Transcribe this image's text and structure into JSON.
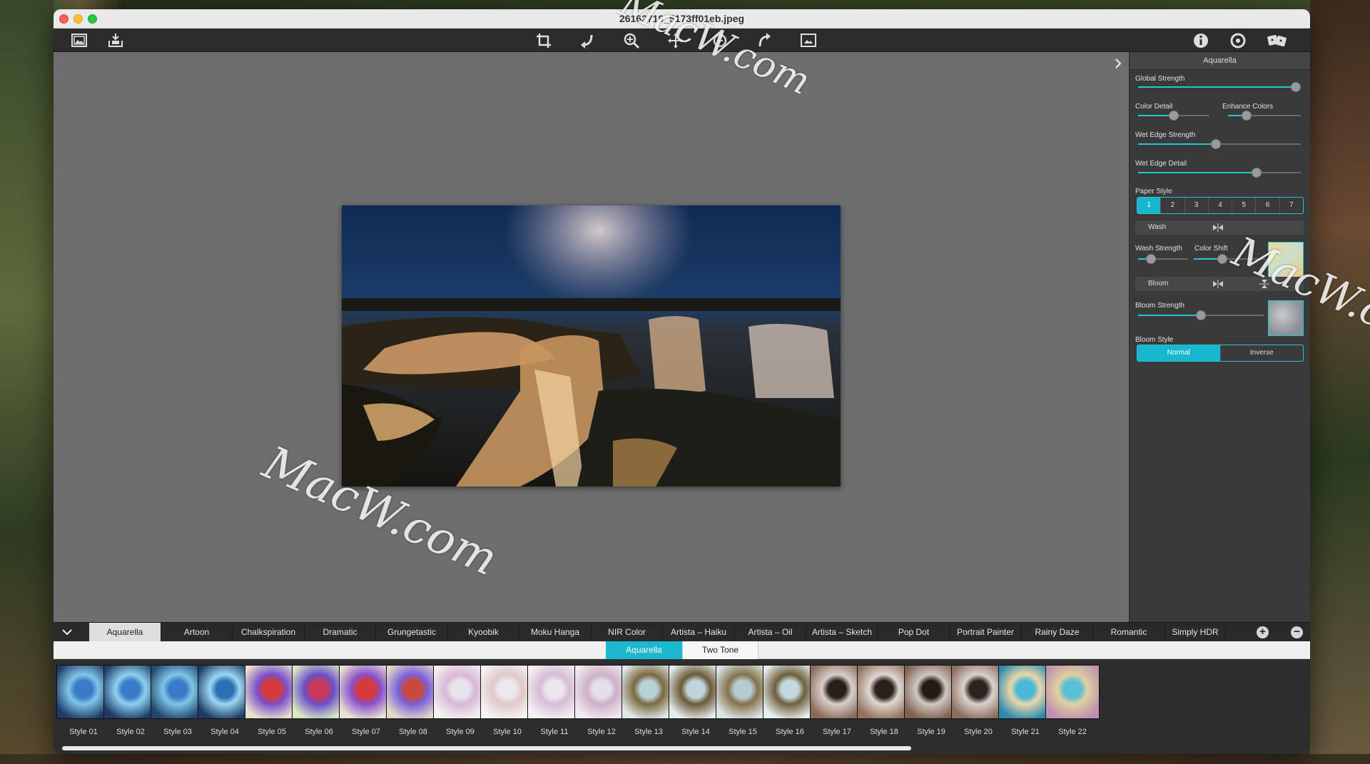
{
  "window": {
    "title": "26162719_5173ff01eb.jpeg"
  },
  "panel": {
    "title": "Aquarella",
    "global_strength": {
      "label": "Global Strength",
      "value": 0.97
    },
    "color_detail": {
      "label": "Color Detail",
      "value": 0.5
    },
    "enhance_colors": {
      "label": "Enhance Colors",
      "value": 0.25
    },
    "wet_edge_strength": {
      "label": "Wet Edge Strength",
      "value": 0.48
    },
    "wet_edge_detail": {
      "label": "Wet Edge Detail",
      "value": 0.73
    },
    "paper_style": {
      "label": "Paper Style",
      "options": [
        "1",
        "2",
        "3",
        "4",
        "5",
        "6",
        "7"
      ],
      "selected": "1"
    },
    "wash": {
      "label": "Wash"
    },
    "wash_strength": {
      "label": "Wash Strength",
      "value": 0.25
    },
    "color_shift": {
      "label": "Color Shift",
      "value": 0.4
    },
    "bloom": {
      "label": "Bloom"
    },
    "bloom_strength": {
      "label": "Bloom Strength",
      "value": 0.5
    },
    "bloom_style": {
      "label": "Bloom Style",
      "options": [
        "Normal",
        "Inverse"
      ],
      "selected": "Normal"
    }
  },
  "tabs": [
    "Aquarella",
    "Artoon",
    "Chalkspiration",
    "Dramatic",
    "Grungetastic",
    "Kyoobik",
    "Moku Hanga",
    "NIR Color",
    "Artista – Haiku",
    "Artista – Oil",
    "Artista – Sketch",
    "Pop Dot",
    "Portrait Painter",
    "Rainy Daze",
    "Romantic",
    "Simply HDR"
  ],
  "active_tab": "Aquarella",
  "subtabs": [
    "Aquarella",
    "Two Tone"
  ],
  "active_subtab": "Aquarella",
  "styles": [
    "Style 01",
    "Style 02",
    "Style 03",
    "Style 04",
    "Style 05",
    "Style 06",
    "Style 07",
    "Style 08",
    "Style 09",
    "Style 10",
    "Style 11",
    "Style 12",
    "Style 13",
    "Style 14",
    "Style 15",
    "Style 16",
    "Style 17",
    "Style 18",
    "Style 19",
    "Style 20",
    "Style 21",
    "Style 22"
  ],
  "icons": {
    "toolbar_left": [
      "open-image-icon",
      "save-icon"
    ],
    "toolbar_center": [
      "crop-icon",
      "rotate-icon",
      "zoom-icon",
      "pan-icon",
      "undo-icon",
      "redo-icon",
      "compare-icon"
    ],
    "toolbar_right": [
      "info-icon",
      "settings-icon",
      "random-icon"
    ]
  },
  "watermarks": [
    "MacW.com",
    "MacW.com",
    "MacW.com"
  ],
  "colors": {
    "accent": "#25c6d9",
    "toolbar": "#2c2c2c",
    "panel": "#3a3a3a"
  }
}
